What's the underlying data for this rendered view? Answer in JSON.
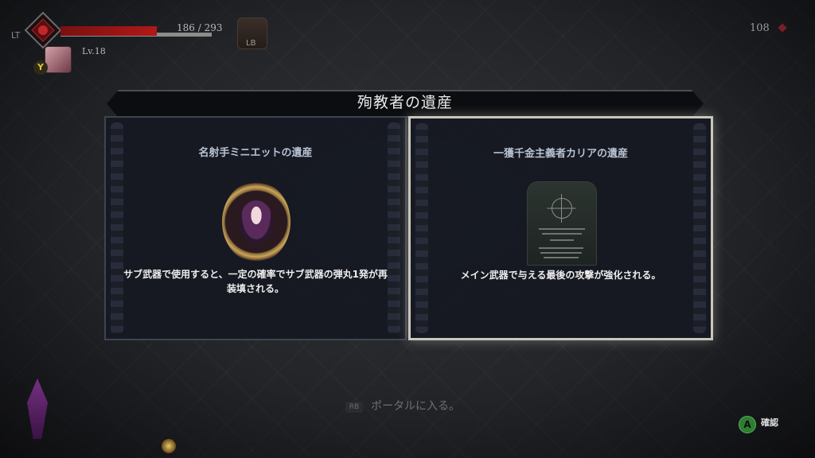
{
  "hud": {
    "lt_label": "LT",
    "hp_text": "186 / 293",
    "hp_current": 186,
    "hp_max": 293,
    "level_text": "Lv.18",
    "y_button": "Y",
    "lb_label": "LB",
    "currency": "108"
  },
  "dialog": {
    "title": "殉教者の遺産",
    "cards": [
      {
        "title": "名射手ミニエットの遺産",
        "description": "サブ武器で使用すると、一定の確率でサブ武器の弾丸1発が再装填される。",
        "icon": "portrait-frame-icon",
        "selected": false
      },
      {
        "title": "一獲千金主義者カリアの遺産",
        "description": "メイン武器で与える最後の攻撃が強化される。",
        "icon": "gravestone-icon",
        "selected": true
      }
    ]
  },
  "footer": {
    "rb_label": "RB",
    "portal_hint": "ポータルに入る。",
    "a_button": "A",
    "confirm_label": "確認"
  },
  "colors": {
    "hp": "#b01818",
    "selected_border": "#c9c6bc",
    "confirm_button": "#2e7d32"
  }
}
